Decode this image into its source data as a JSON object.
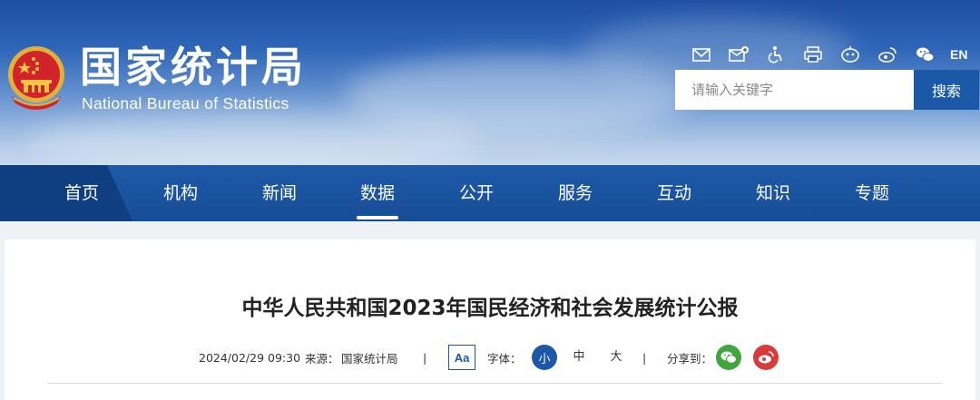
{
  "header": {
    "logo_cn": "国家统计局",
    "logo_en": "National Bureau of Statistics",
    "tools": [
      "mail-icon",
      "mail-add-icon",
      "accessibility-icon",
      "print-icon",
      "robot-icon",
      "weibo-icon",
      "wechat-icon"
    ],
    "lang_label": "EN",
    "search": {
      "placeholder": "请输入关键字",
      "button_label": "搜索"
    }
  },
  "nav": {
    "items": [
      "首页",
      "机构",
      "新闻",
      "数据",
      "公开",
      "服务",
      "互动",
      "知识",
      "专题"
    ],
    "active": "数据"
  },
  "article": {
    "title": "中华人民共和国2023年国民经济和社会发展统计公报",
    "meta": {
      "datetime": "2024/02/29 09:30",
      "source_label": "来源：",
      "source": "国家统计局",
      "separator": "|",
      "font_toggle": "Aa",
      "font_label": "字体：",
      "sizes": [
        "小",
        "中",
        "大"
      ],
      "active_size": "小",
      "share_label": "分享到："
    }
  },
  "colors": {
    "brand_blue": "#1b58a7",
    "nav_bg": "#1a52a0",
    "wechat": "#3fa63d",
    "weibo": "#d93a3a"
  }
}
